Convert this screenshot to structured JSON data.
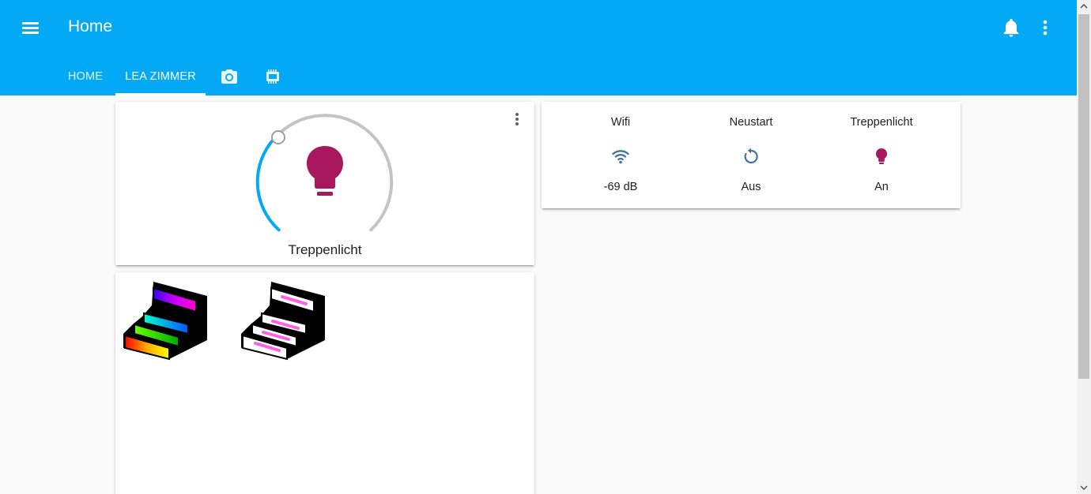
{
  "header": {
    "title": "Home",
    "tabs": [
      {
        "label": "HOME",
        "active": false
      },
      {
        "label": "LEA ZIMMER",
        "active": true
      },
      {
        "icon": "camera-icon"
      },
      {
        "icon": "chip-icon"
      }
    ]
  },
  "light_card": {
    "name": "Treppenlicht",
    "state": "on",
    "icon": "lightbulb-icon",
    "icon_color": "#a8185f"
  },
  "glance": [
    {
      "name": "Wifi",
      "state": "-69 dB",
      "icon": "wifi-icon"
    },
    {
      "name": "Neustart",
      "state": "Aus",
      "icon": "restart-icon"
    },
    {
      "name": "Treppenlicht",
      "state": "An",
      "icon": "lightbulb-icon"
    }
  ],
  "scenes": [
    {
      "icon": "rainbow-stairs-image"
    },
    {
      "icon": "pink-stairs-image"
    }
  ],
  "colors": {
    "primary": "#03a9f4",
    "icon_blue": "#44739e",
    "light_on": "#a8185f",
    "slider": "#03a9f4",
    "track": "#c4c4c4"
  }
}
